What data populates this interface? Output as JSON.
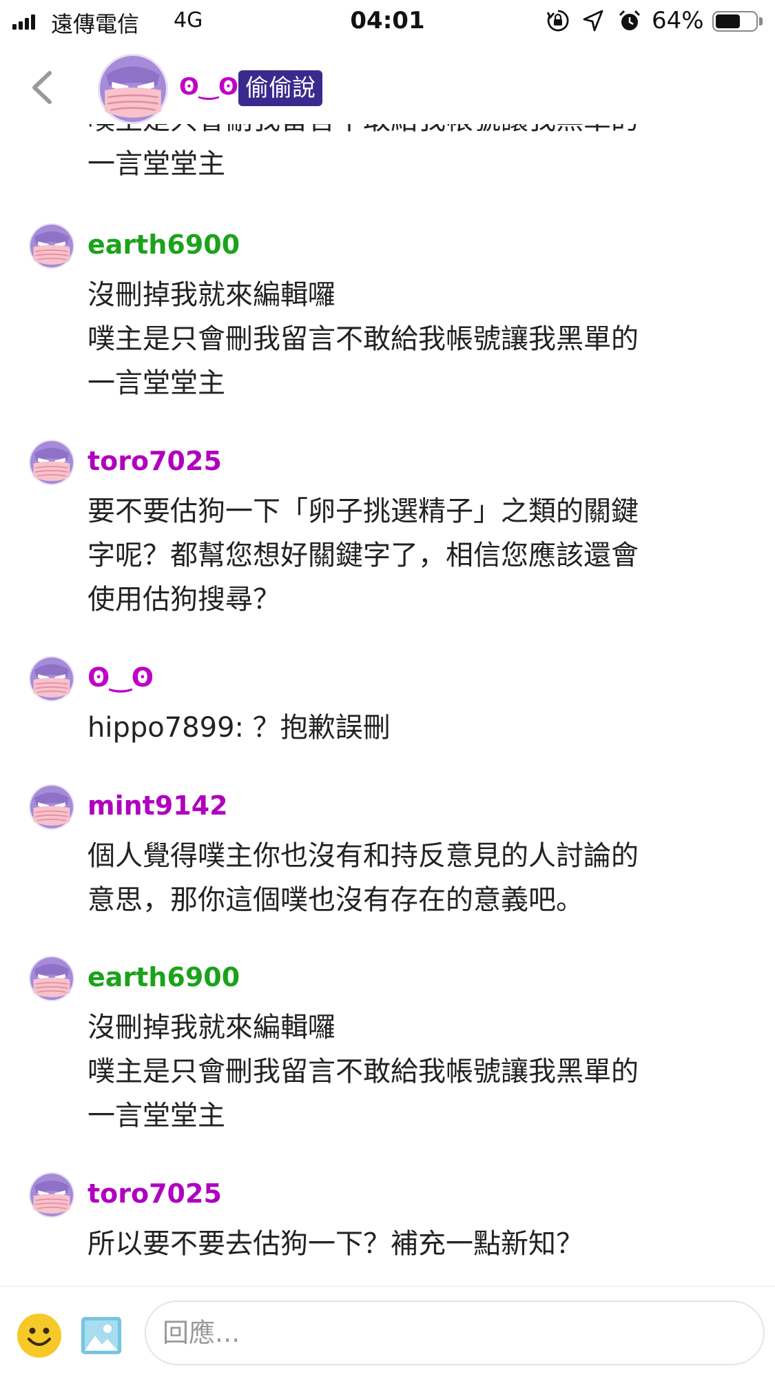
{
  "status_bar": {
    "carrier": "遠傳電信",
    "network": "4G",
    "time": "04:01",
    "battery_percent_text": "64%",
    "battery_level": 0.64,
    "icons": [
      "signal-bars-icon",
      "rotation-lock-icon",
      "location-arrow-icon",
      "alarm-clock-icon",
      "battery-icon"
    ]
  },
  "header": {
    "owner_name": "ʘ‿ʘ",
    "badge": "偷偷說",
    "back_icon": "chevron-left-icon",
    "avatar_icon": "anonymous-masked-avatar"
  },
  "feed": {
    "cut_off_text": [
      "噗主是只會刪我留言不敢給我帳號讓我黑單的",
      "一言堂堂主"
    ],
    "responses": [
      {
        "user": "earth6900",
        "color": "#1aa31a",
        "lines": [
          "沒刪掉我就來編輯囉",
          "噗主是只會刪我留言不敢給我帳號讓我黑單的",
          "一言堂堂主"
        ]
      },
      {
        "user": "toro7025",
        "color": "#b000bf",
        "lines": [
          "要不要估狗一下「卵子挑選精子」之類的關鍵",
          "字呢？都幫您想好關鍵字了，相信您應該還會",
          "使用估狗搜尋？"
        ]
      },
      {
        "user": "ʘ‿ʘ",
        "color": "#c000c8",
        "lines": [
          "hippo7899: ？抱歉誤刪"
        ]
      },
      {
        "user": "mint9142",
        "color": "#b000bf",
        "lines": [
          "個人覺得噗主你也沒有和持反意見的人討論的",
          "意思，那你這個噗也沒有存在的意義吧。"
        ]
      },
      {
        "user": "earth6900",
        "color": "#1aa31a",
        "lines": [
          "沒刪掉我就來編輯囉",
          "噗主是只會刪我留言不敢給我帳號讓我黑單的",
          "一言堂堂主"
        ]
      },
      {
        "user": "toro7025",
        "color": "#b000bf",
        "lines": [
          "所以要不要去估狗一下？補充一點新知？"
        ]
      }
    ]
  },
  "input_bar": {
    "placeholder": "回應...",
    "emoji_icon": "smiley-emoji-icon",
    "image_icon": "image-upload-icon"
  },
  "colors": {
    "badge_bg": "#3b2a8e",
    "avatar_purple": "#9b7fd4",
    "mask_pink": "#f4b6c0"
  }
}
